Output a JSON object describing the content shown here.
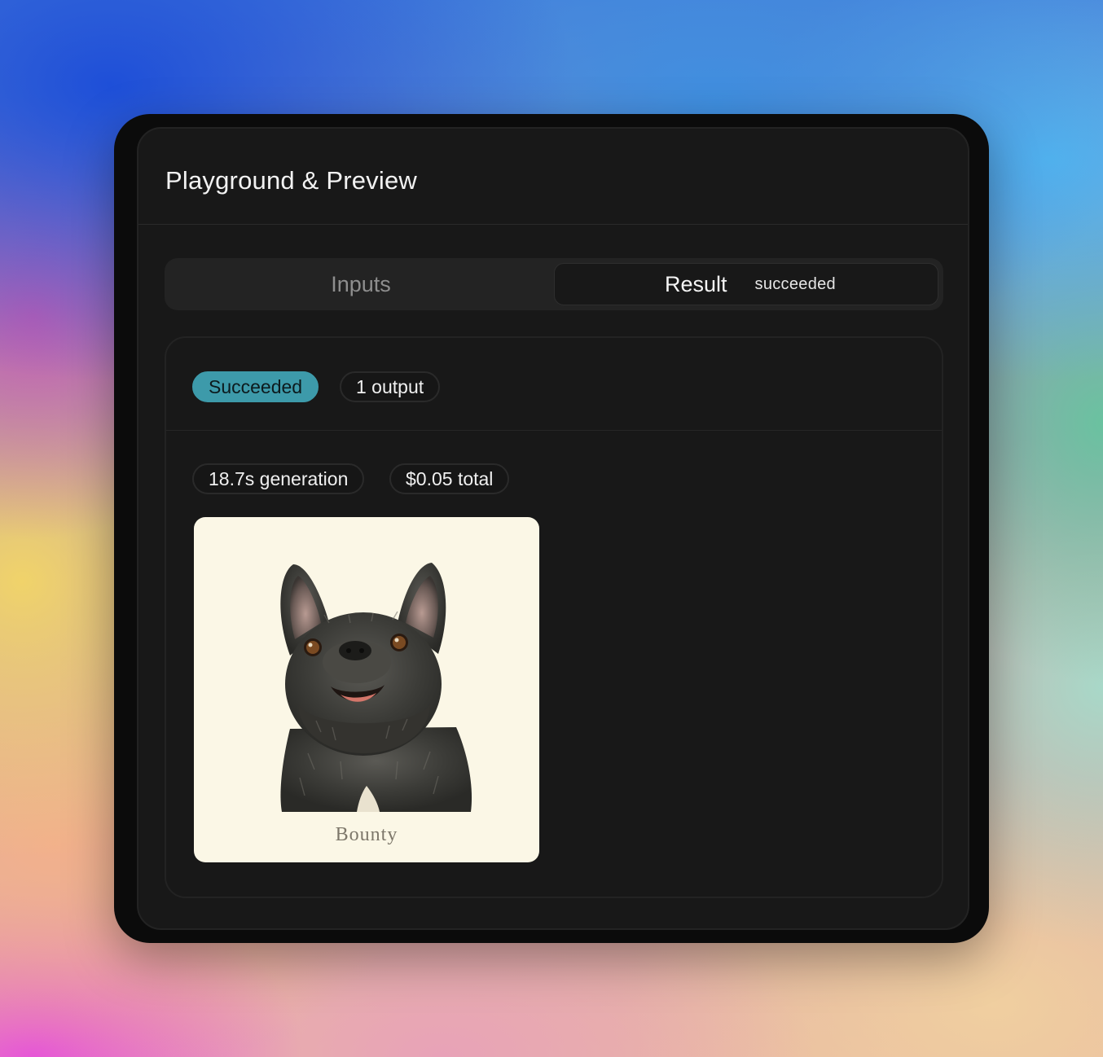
{
  "panel": {
    "title": "Playground & Preview"
  },
  "tabs": [
    {
      "label": "Inputs",
      "active": false
    },
    {
      "label": "Result",
      "active": true,
      "status": "succeeded"
    }
  ],
  "result": {
    "status_badge": "Succeeded",
    "outputs_count": "1 output",
    "generation_time": "18.7s generation",
    "total_cost": "$0.05 total",
    "output_caption": "Bounty"
  },
  "colors": {
    "status_succeeded": "#3d9aaa",
    "panel_bg": "#181818",
    "thumbnail_bg": "#fbf7e6"
  },
  "icons": {
    "output_image": "french-bulldog-illustration"
  }
}
